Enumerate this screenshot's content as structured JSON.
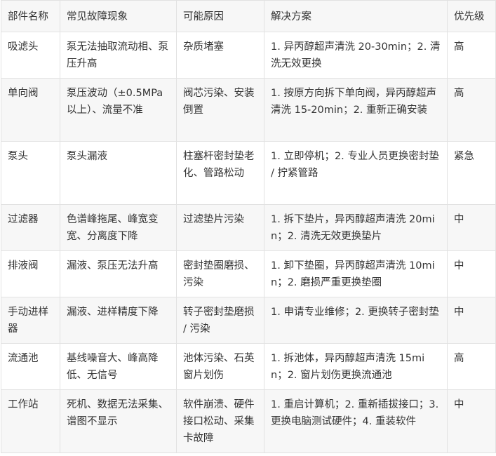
{
  "table": {
    "headers": [
      "部件名称",
      "常见故障现象",
      "可能原因",
      "解决方案",
      "优先级"
    ],
    "rows": [
      [
        "吸滤头",
        "泵无法抽取流动相、泵压升高",
        "杂质堵塞",
        "1. 异丙醇超声清洗 20-30min；2. 清洗无效更换",
        "高"
      ],
      [
        "单向阀",
        "泵压波动（±0.5MPa以上）、流量不准",
        "阀芯污染、安装倒置",
        "1. 按原方向拆下单向阀，异丙醇超声清洗 15-20min；2. 重新正确安装",
        "高"
      ],
      [
        "泵头",
        "泵头漏液",
        "柱塞杆密封垫老化、管路松动",
        "1. 立即停机；2. 专业人员更换密封垫 / 拧紧管路",
        "紧急"
      ],
      [
        "过滤器",
        "色谱峰拖尾、峰宽变宽、分离度下降",
        "过滤垫片污染",
        "1. 拆下垫片，异丙醇超声清洗 20min；2. 清洗无效更换垫片",
        "中"
      ],
      [
        "排液阀",
        "漏液、泵压无法升高",
        "密封垫圈磨损、污染",
        "1. 卸下垫圈，异丙醇超声清洗 10min；2. 磨损严重更换垫圈",
        "中"
      ],
      [
        "手动进样器",
        "漏液、进样精度下降",
        "转子密封垫磨损 / 污染",
        "1. 申请专业维修；2. 更换转子密封垫",
        "中"
      ],
      [
        "流通池",
        "基线噪音大、峰高降低、无信号",
        "池体污染、石英窗片划伤",
        "1. 拆池体，异丙醇超声清洗 15min；2. 窗片划伤更换流通池",
        "高"
      ],
      [
        "工作站",
        "死机、数据无法采集、谱图不显示",
        "软件崩溃、硬件接口松动、采集卡故障",
        "1. 重启计算机；2. 重新插拔接口；3. 更换电脑测试硬件；4. 重装软件",
        "中"
      ]
    ]
  }
}
